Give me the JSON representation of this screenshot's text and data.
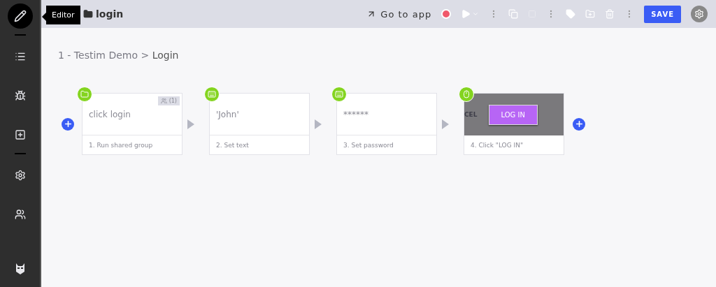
{
  "sidebar": {
    "items": [
      {
        "selected": true
      },
      {
        "selected": false
      },
      {
        "selected": false
      },
      {
        "selected": false
      },
      {
        "selected": false
      },
      {
        "selected": false
      },
      {
        "selected": false
      }
    ],
    "tooltip": "Editor"
  },
  "header": {
    "title": "login",
    "go_to_app": "Go to app",
    "save": "SAVE"
  },
  "breadcrumb": {
    "project": "1 - Testim Demo",
    "separator": ">",
    "test": "Login"
  },
  "steps": [
    {
      "kind": "shared_group",
      "text": "click login",
      "badge": "(1)",
      "caption": "1. Run shared group"
    },
    {
      "kind": "set_text",
      "text": "'John'",
      "caption": "2. Set text"
    },
    {
      "kind": "set_text",
      "text": "******",
      "caption": "3. Set password"
    },
    {
      "kind": "click",
      "side_text": "CEL",
      "button_text": "LOG IN",
      "caption": "4. Click \"LOG IN\""
    }
  ]
}
